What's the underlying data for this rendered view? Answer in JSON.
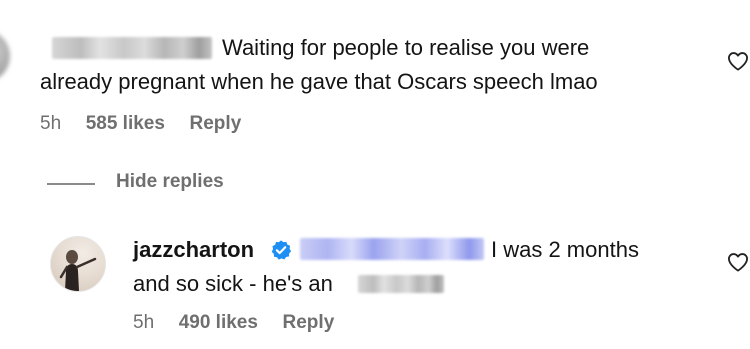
{
  "comment_1": {
    "text_line_1": "Waiting for people to realise you were",
    "text_line_2": "already pregnant when he gave that Oscars speech lmao",
    "time": "5h",
    "likes": "585 likes",
    "reply_label": "Reply",
    "heart_icon": "heart-outline"
  },
  "replies_toggle": {
    "label": "Hide replies"
  },
  "reply_1": {
    "username": "jazzcharton",
    "verified_icon": "verified-badge",
    "text_line_1": "I was 2 months",
    "text_line_2_prefix": "and so sick - he's an",
    "time": "5h",
    "likes": "490 likes",
    "reply_label": "Reply",
    "heart_icon": "heart-outline"
  },
  "colors": {
    "text_primary": "#141414",
    "text_secondary": "#6f6f6f",
    "verified_blue": "#1d8ff5",
    "mention_blur": "#aeb5f2"
  }
}
